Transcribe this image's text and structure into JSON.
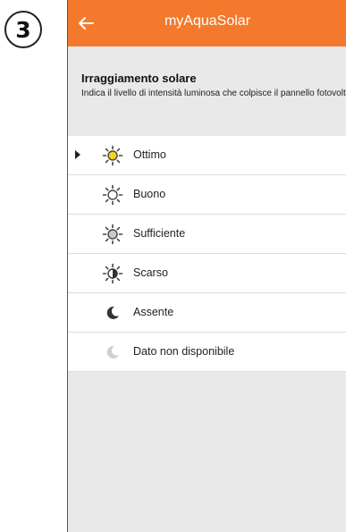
{
  "step": "3",
  "appbar": {
    "title": "myAquaSolar",
    "color": "#f4792c"
  },
  "section": {
    "title": "Irraggiamento solare",
    "description": "Indica il livello di intensità luminosa che colpisce il pannello fotovoltaico."
  },
  "options": [
    {
      "label": "Ottimo",
      "icon": "sun-optimal-icon",
      "selected": true
    },
    {
      "label": "Buono",
      "icon": "sun-good-icon",
      "selected": false
    },
    {
      "label": "Sufficiente",
      "icon": "sun-sufficient-icon",
      "selected": false
    },
    {
      "label": "Scarso",
      "icon": "sun-poor-icon",
      "selected": false
    },
    {
      "label": "Assente",
      "icon": "moon-icon",
      "selected": false
    },
    {
      "label": "Dato non disponibile",
      "icon": "moon-faded-icon",
      "selected": false
    }
  ]
}
